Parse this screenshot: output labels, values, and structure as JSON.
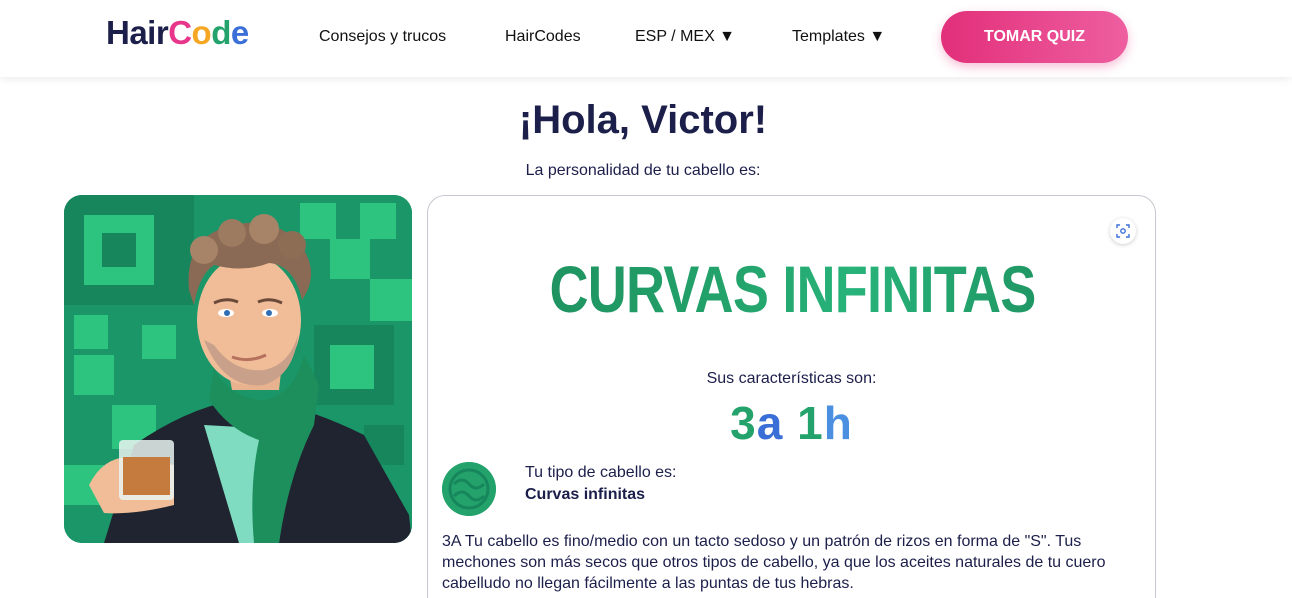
{
  "nav": {
    "logo_hair": "Hair",
    "logo_c": "C",
    "logo_o": "o",
    "logo_d": "d",
    "logo_e": "e",
    "items": [
      {
        "label": "Consejos y trucos"
      },
      {
        "label": "HairCodes"
      },
      {
        "label": "ESP / MEX ▼"
      },
      {
        "label": "Templates ▼"
      }
    ],
    "quiz_button": "TOMAR QUIZ"
  },
  "greeting": "¡Hola, Victor!",
  "subtitle": "La personalidad de tu cabello es:",
  "card": {
    "persona_title": "CURVAS INFINITAS",
    "characteristics_label": "Sus características son:",
    "code_parts": [
      "3",
      "a",
      " 1",
      "h"
    ],
    "type_label": "Tu tipo de cabello es:",
    "type_value": "Curvas infinitas",
    "description": "3A Tu cabello es fino/medio con un tacto sedoso y un patrón de rizos en forma de \"S\". Tus mechones son más secos que otros tipos de cabello, ya que los aceites naturales de tu cuero cabelludo no llegan fácilmente a las puntas de tus hebras."
  },
  "icons": {
    "screenshot": "screenshot-icon",
    "hair_type": "curly-hair-icon",
    "avatar": "avatar-illustration"
  },
  "colors": {
    "brand_navy": "#1b1f4a",
    "accent_pink": "#e22f7a",
    "accent_green": "#23a36b",
    "accent_blue": "#3b6fd8"
  }
}
